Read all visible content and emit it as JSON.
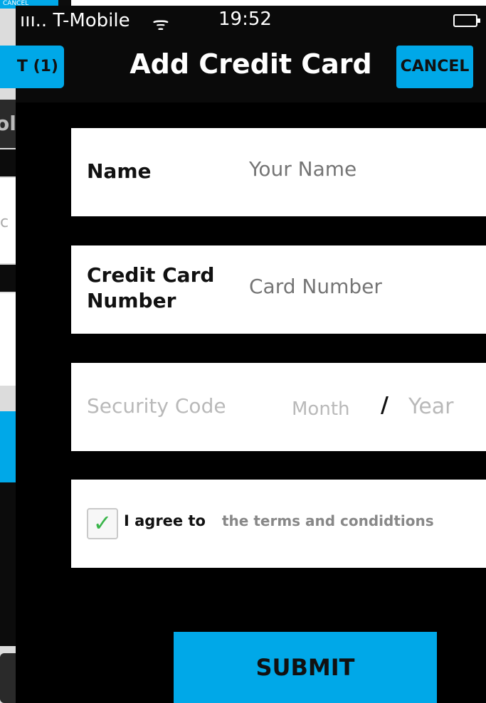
{
  "background_app": {
    "tab_label": "CANCEL",
    "back_label": "T (1)",
    "section_label": "ol",
    "partial_text": "c",
    "plus_symbol": "+"
  },
  "status_bar": {
    "carrier": "ııı.. T-Mobile",
    "wifi_symbol": "ᯤ",
    "time": "19:52"
  },
  "navbar": {
    "title": "Add Credit Card",
    "cancel_label": "CANCEL",
    "back_label": "T (1)"
  },
  "form": {
    "name_label": "Name",
    "name_placeholder": "Your Name",
    "card_label_line1": "Credit Card",
    "card_label_line2": "Number",
    "card_placeholder": "Card Number",
    "security_placeholder": "Security Code",
    "month_placeholder": "Month",
    "date_separator": "/",
    "year_placeholder": "Year",
    "agree_checked": true,
    "agree_label": "I agree to",
    "terms_label": "the terms and condidtions",
    "checkmark": "✓"
  },
  "submit_label": "SUBMIT",
  "colors": {
    "accent": "#00a8e8",
    "background": "#000000",
    "card": "#ffffff",
    "placeholder": "#b9b9b9",
    "check": "#39b54a"
  }
}
